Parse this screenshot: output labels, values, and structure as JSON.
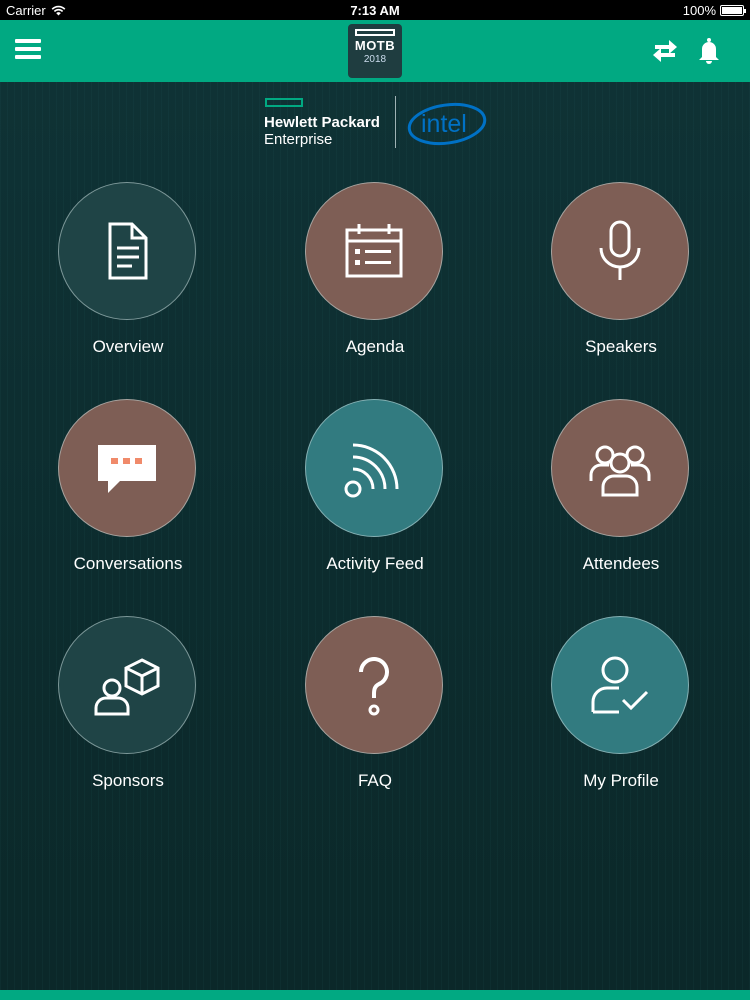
{
  "status_bar": {
    "carrier": "Carrier",
    "time": "7:13 AM",
    "battery": "100%"
  },
  "header": {
    "logo_name": "MOTB",
    "logo_year": "2018",
    "menu_icon": "hamburger-icon",
    "sync_icon": "sync-icon",
    "bell_icon": "bell-icon",
    "bar_color": "#01a982"
  },
  "sponsors": {
    "hpe_line1": "Hewlett Packard",
    "hpe_line2": "Enterprise",
    "intel": "intel"
  },
  "tiles": [
    {
      "label": "Overview",
      "icon": "document-icon",
      "color": "#1f4446"
    },
    {
      "label": "Agenda",
      "icon": "calendar-icon",
      "color": "#7e5e55"
    },
    {
      "label": "Speakers",
      "icon": "microphone-icon",
      "color": "#7e5e55"
    },
    {
      "label": "Conversations",
      "icon": "chat-bubble-icon",
      "color": "#7e5e55"
    },
    {
      "label": "Activity Feed",
      "icon": "rss-feed-icon",
      "color": "#327b80"
    },
    {
      "label": "Attendees",
      "icon": "group-icon",
      "color": "#7e5e55"
    },
    {
      "label": "Sponsors",
      "icon": "sponsor-box-icon",
      "color": "#1f4446"
    },
    {
      "label": "FAQ",
      "icon": "question-icon",
      "color": "#7e5e55"
    },
    {
      "label": "My Profile",
      "icon": "user-check-icon",
      "color": "#327b80"
    }
  ]
}
